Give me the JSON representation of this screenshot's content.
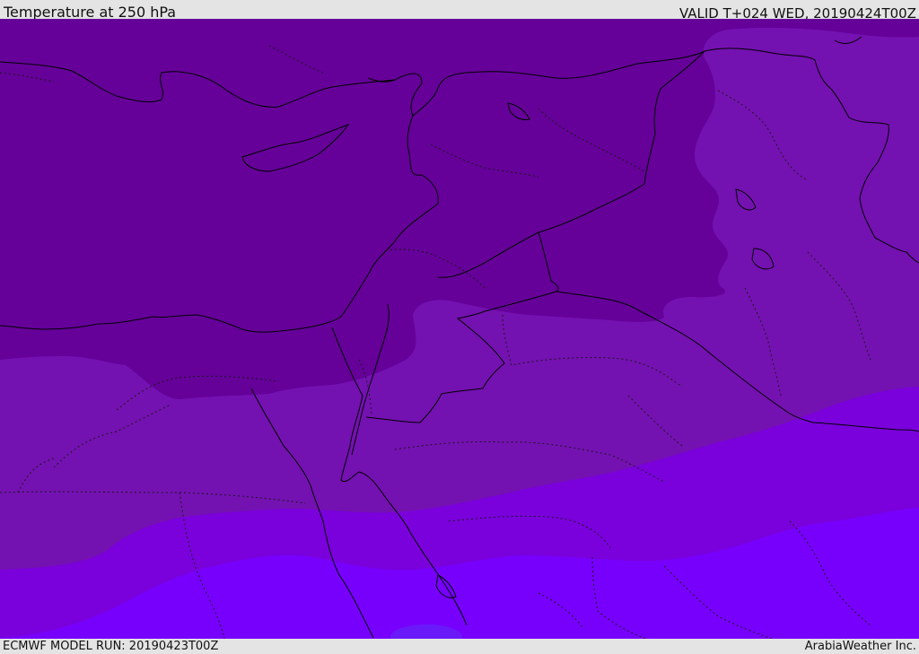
{
  "header": {
    "title": "Temperature at 250 hPa",
    "valid": "VALID T+024 WED, 20190424T00Z"
  },
  "footer": {
    "model_run": "ECMWF MODEL RUN: 20190423T00Z",
    "credit": "ArabiaWeather Inc."
  },
  "colors": {
    "band_coldest": "#650099",
    "band_cold": "#7411b1",
    "band_mid": "#7a00dc",
    "band_warm": "#7700fd",
    "band_warmest": "#6a1af8",
    "border_line": "#000000",
    "header_background": "#e4e4e4"
  }
}
